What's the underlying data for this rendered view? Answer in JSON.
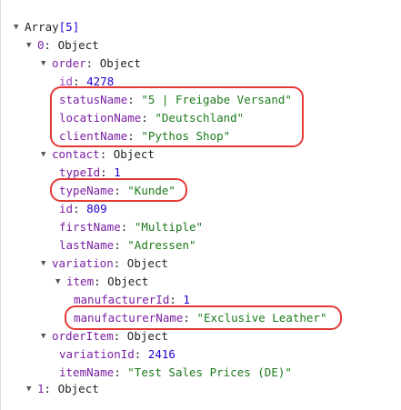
{
  "tree": {
    "root": {
      "label": "Array",
      "length": "[5]"
    },
    "item0": {
      "index": "0",
      "type": "Object"
    },
    "order": {
      "key": "order",
      "type": "Object",
      "id": {
        "key": "id",
        "value": "4278"
      },
      "statusName": {
        "key": "statusName",
        "value": "\"5 | Freigabe Versand\""
      },
      "locationName": {
        "key": "locationName",
        "value": "\"Deutschland\""
      },
      "clientName": {
        "key": "clientName",
        "value": "\"Pythos Shop\""
      }
    },
    "contact": {
      "key": "contact",
      "type": "Object",
      "typeId": {
        "key": "typeId",
        "value": "1"
      },
      "typeName": {
        "key": "typeName",
        "value": "\"Kunde\""
      },
      "id": {
        "key": "id",
        "value": "809"
      },
      "firstName": {
        "key": "firstName",
        "value": "\"Multiple\""
      },
      "lastName": {
        "key": "lastName",
        "value": "\"Adressen\""
      }
    },
    "variation": {
      "key": "variation",
      "type": "Object",
      "item": {
        "key": "item",
        "type": "Object",
        "manufacturerId": {
          "key": "manufacturerId",
          "value": "1"
        },
        "manufacturerName": {
          "key": "manufacturerName",
          "value": "\"Exclusive Leather\""
        }
      }
    },
    "orderItem": {
      "key": "orderItem",
      "type": "Object",
      "variationId": {
        "key": "variationId",
        "value": "2416"
      },
      "itemName": {
        "key": "itemName",
        "value": "\"Test Sales Prices (DE)\""
      }
    },
    "item1": {
      "index": "1",
      "type": "Object"
    }
  },
  "icons": {
    "expanded": "triangle-down-icon"
  },
  "colors": {
    "key": "#7a1fa2",
    "number": "#1c00cf",
    "string": "#1a7a1a",
    "highlight": "#e53935"
  }
}
